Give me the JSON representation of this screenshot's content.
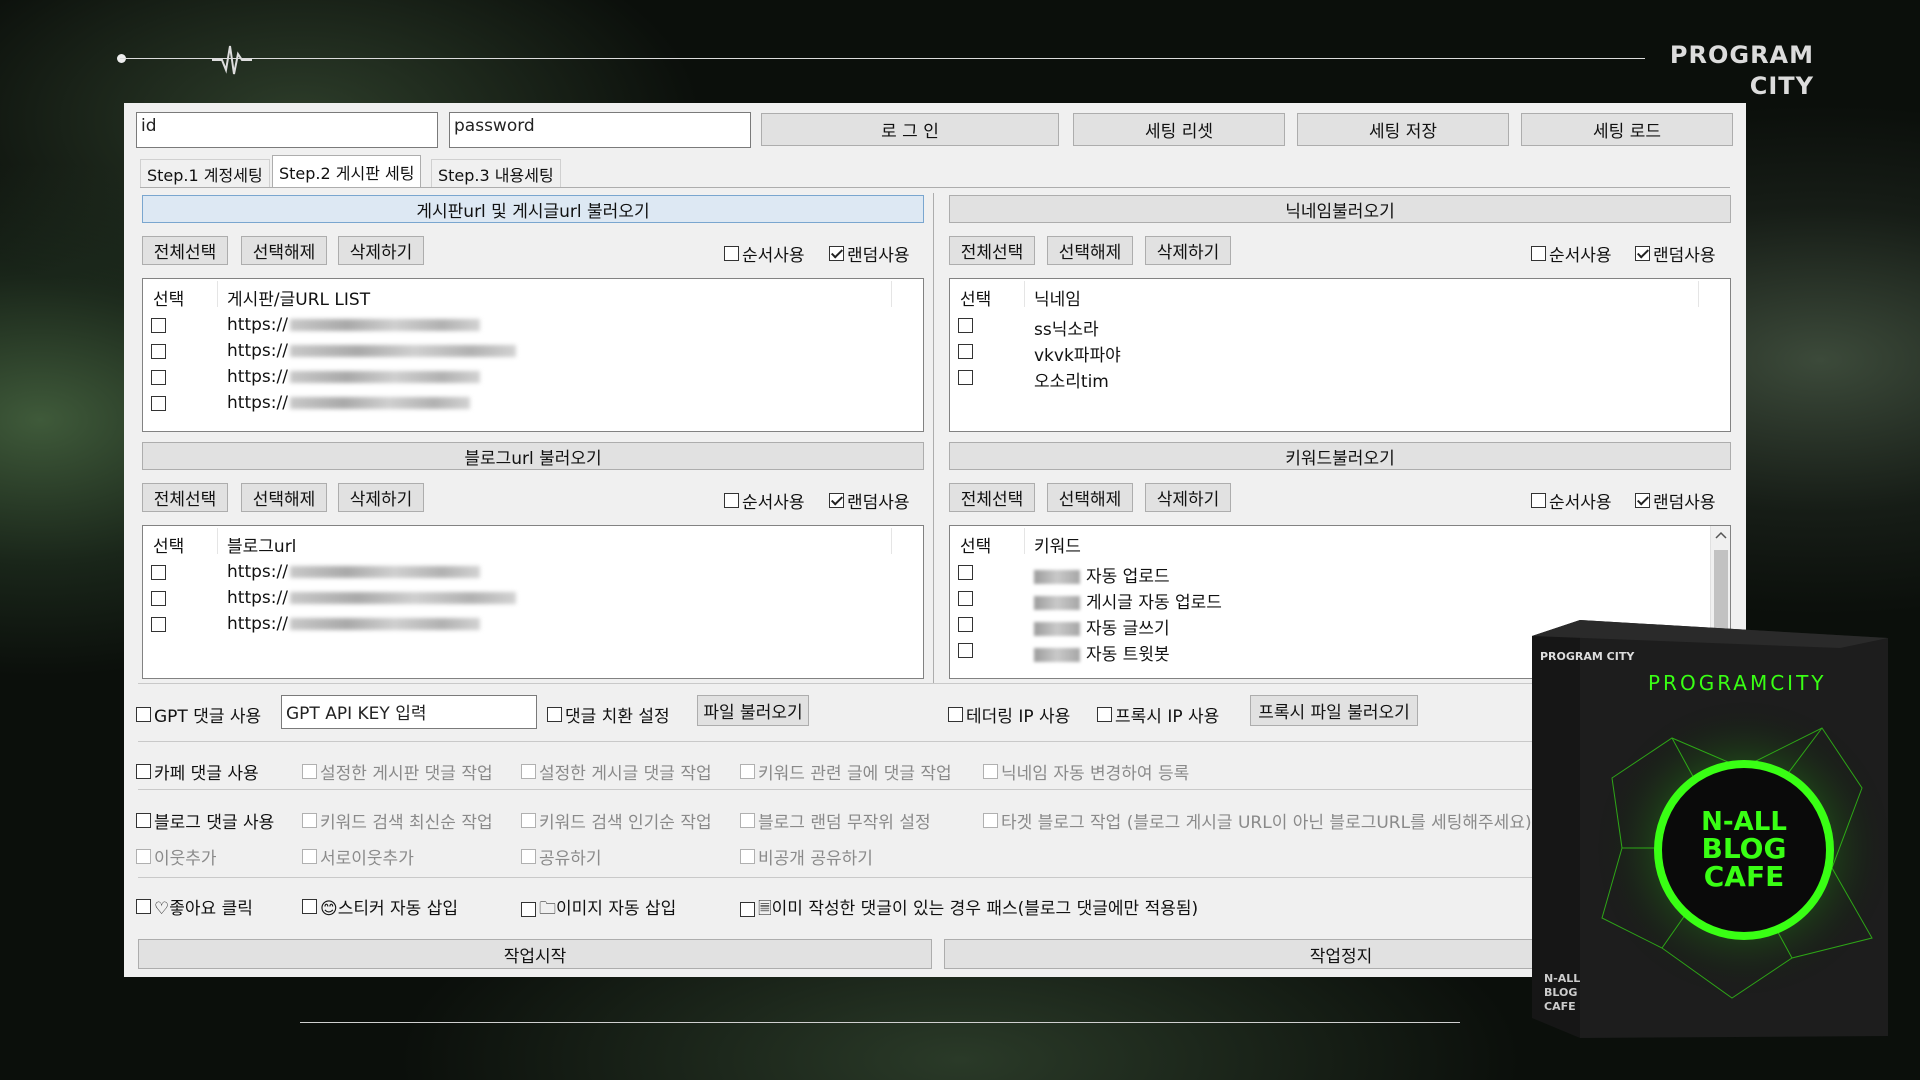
{
  "brand": {
    "line1": "PROGRAM",
    "line2": "CITY"
  },
  "login": {
    "id_value": "id",
    "password_value": "password",
    "login_label": "로 그 인",
    "reset_label": "세팅 리셋",
    "save_label": "세팅 저장",
    "load_label": "세팅 로드"
  },
  "tabs": [
    {
      "label": "Step.1 계정세팅"
    },
    {
      "label": "Step.2 게시판 세팅"
    },
    {
      "label": "Step.3 내용세팅"
    }
  ],
  "buttons": {
    "select_all": "전체선택",
    "deselect": "선택해제",
    "delete": "삭제하기"
  },
  "options": {
    "order": "순서사용",
    "random": "랜덤사용"
  },
  "board_panel": {
    "title": "게시판url 및 게시글url 불러오기",
    "col_select": "선택",
    "col_list": "게시판/글URL LIST",
    "rows": [
      "https://",
      "https://",
      "https://",
      "https://"
    ]
  },
  "nick_panel": {
    "title": "닉네임불러오기",
    "col_select": "선택",
    "col_list": "닉네임",
    "rows": [
      "ss닉소라",
      "vkvk파파야",
      "오소리tim"
    ]
  },
  "blog_panel": {
    "title": "블로그url 불러오기",
    "col_select": "선택",
    "col_list": "블로그url",
    "rows": [
      "https://",
      "https://",
      "https://"
    ]
  },
  "keyword_panel": {
    "title": "키워드불러오기",
    "col_select": "선택",
    "col_list": "키워드",
    "rows": [
      "자동 업로드",
      "게시글 자동 업로드",
      "자동 글쓰기",
      "자동 트윗봇"
    ]
  },
  "gpt": {
    "use_label": "GPT 댓글 사용",
    "key_placeholder": "GPT API KEY 입력",
    "replace_label": "댓글 치환 설정",
    "file_button": "파일 불러오기",
    "tethering": "테더링 IP 사용",
    "proxy": "프록시 IP 사용",
    "proxy_file": "프록시 파일 불러오기"
  },
  "cafe": {
    "use": "카페 댓글 사용",
    "opt1": "설정한 게시판 댓글 작업",
    "opt2": "설정한 게시글 댓글 작업",
    "opt3": "키워드 관련 글에 댓글 작업",
    "opt4": "닉네임 자동 변경하여 등록"
  },
  "blog": {
    "use": "블로그 댓글 사용",
    "opt1": "키워드 검색 최신순 작업",
    "opt2": "키워드 검색 인기순 작업",
    "opt3": "블로그 랜덤 무작위 설정",
    "opt4": "타겟 블로그 작업 (블로그 게시글 URL이 아닌 블로그URL를 세팅해주세요)",
    "sub1": "이웃추가",
    "sub2": "서로이웃추가",
    "sub3": "공유하기",
    "sub4": "비공개 공유하기"
  },
  "extras": {
    "like": "♡좋아요 클릭",
    "sticker": "😊스티커 자동 삽입",
    "image": "🗀이미지 자동 삽입",
    "pass": "🗏이미 작성한 댓글이 있는 경우 패스(블로그 댓글에만 적용됨)"
  },
  "actions": {
    "start": "작업시작",
    "stop": "작업정지"
  },
  "product": {
    "side_brand": "PROGRAM CITY",
    "title": "PROGRAMCITY",
    "logo1": "N-ALL",
    "logo2": "BLOG",
    "logo3": "CAFE",
    "spine1": "N-ALL",
    "spine2": "BLOG",
    "spine3": "CAFE"
  },
  "colors": {
    "accent": "#39ff14",
    "window_bg": "#f0f0f0",
    "page_bg": "#0b0f0b"
  }
}
